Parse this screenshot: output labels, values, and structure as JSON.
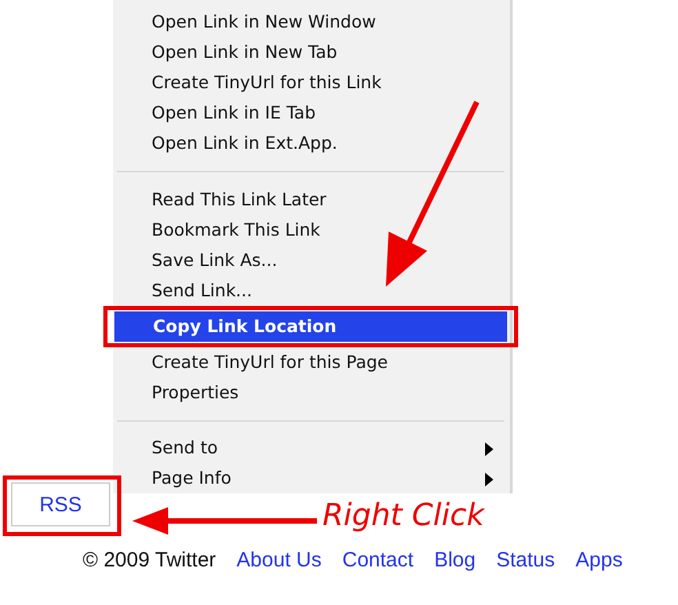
{
  "context_menu": {
    "items": [
      {
        "kind": "item",
        "label": "Open Link in New Window",
        "selected": false
      },
      {
        "kind": "item",
        "label": "Open Link in New Tab",
        "selected": false
      },
      {
        "kind": "item",
        "label": "Create TinyUrl for this Link",
        "selected": false
      },
      {
        "kind": "item",
        "label": "Open Link in IE Tab",
        "selected": false
      },
      {
        "kind": "item",
        "label": "Open Link in Ext.App.",
        "selected": false
      },
      {
        "kind": "separator"
      },
      {
        "kind": "item",
        "label": "Read This Link Later",
        "selected": false
      },
      {
        "kind": "item",
        "label": "Bookmark This Link",
        "selected": false
      },
      {
        "kind": "item",
        "label": "Save Link As...",
        "selected": false
      },
      {
        "kind": "item",
        "label": "Send Link...",
        "selected": false
      },
      {
        "kind": "item",
        "label": "Copy Link Location",
        "selected": true
      },
      {
        "kind": "item",
        "label": "Create TinyUrl for this Page",
        "selected": false
      },
      {
        "kind": "item",
        "label": "Properties",
        "selected": false
      },
      {
        "kind": "separator"
      },
      {
        "kind": "submenu",
        "label": "Send to",
        "selected": false
      },
      {
        "kind": "submenu",
        "label": "Page Info",
        "selected": false
      }
    ]
  },
  "rss_button": "RSS",
  "annotation": {
    "callout": "Right Click"
  },
  "footer": {
    "copyright": "© 2009 Twitter",
    "links": [
      "About Us",
      "Contact",
      "Blog",
      "Status",
      "Apps"
    ]
  }
}
